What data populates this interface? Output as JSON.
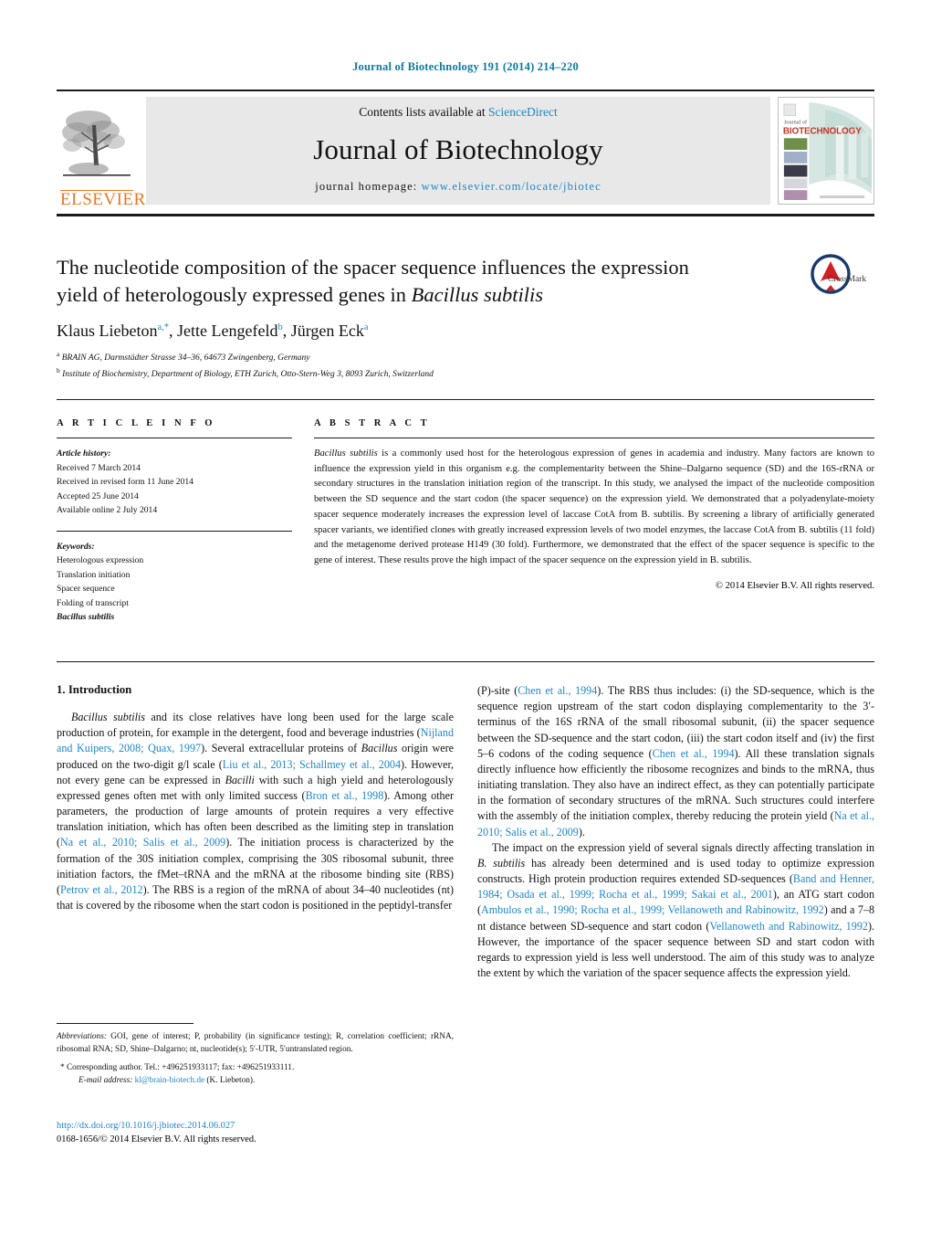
{
  "running_head": "Journal of Biotechnology 191 (2014) 214–220",
  "masthead": {
    "contents_prefix": "Contents lists available at ",
    "sciencedirect": "ScienceDirect",
    "journal_title": "Journal of Biotechnology",
    "homepage_label": "journal homepage:",
    "homepage_url": "www.elsevier.com/locate/jbiotec",
    "publisher": "ELSEVIER",
    "cover_line1": "Journal of",
    "cover_line2": "BIOTECHNOLOGY",
    "link_color": "#1f86c8",
    "brand_orange": "#E77726"
  },
  "article": {
    "title_part1": "The nucleotide composition of the spacer sequence influences the expression yield of heterologously expressed genes in ",
    "title_italic": "Bacillus subtilis",
    "authors_html": "Klaus Liebeton, Jette Lengefeld, Jürgen Eck",
    "authors": [
      {
        "name": "Klaus Liebeton",
        "sup": "a,*"
      },
      {
        "name": "Jette Lengefeld",
        "sup": "b"
      },
      {
        "name": "Jürgen Eck",
        "sup": "a"
      }
    ],
    "affiliations": [
      {
        "sup": "a",
        "text": "BRAIN AG, Darmstädter Strasse 34–36, 64673 Zwingenberg, Germany"
      },
      {
        "sup": "b",
        "text": "Institute of Biochemistry, Department of Biology, ETH Zurich, Otto-Stern-Weg 3, 8093 Zurich, Switzerland"
      }
    ],
    "crossmark_label": "CrossMark"
  },
  "article_info": {
    "heading": "A R T I C L E   I N F O",
    "history_label": "Article history:",
    "history": [
      "Received 7 March 2014",
      "Received in revised form 11 June 2014",
      "Accepted 25 June 2014",
      "Available online 2 July 2014"
    ],
    "keywords_label": "Keywords:",
    "keywords": [
      "Heterologous expression",
      "Translation initiation",
      "Spacer sequence",
      "Folding of transcript",
      "Bacillus subtilis"
    ]
  },
  "abstract": {
    "heading": "A B S T R A C T",
    "lead_italic": "Bacillus subtilis",
    "text": " is a commonly used host for the heterologous expression of genes in academia and industry. Many factors are known to influence the expression yield in this organism e.g. the complementarity between the Shine–Dalgarno sequence (SD) and the 16S-rRNA or secondary structures in the translation initiation region of the transcript. In this study, we analysed the impact of the nucleotide composition between the SD sequence and the start codon (the spacer sequence) on the expression yield. We demonstrated that a polyadenylate-moiety spacer sequence moderately increases the expression level of laccase CotA from B. subtilis. By screening a library of artificially generated spacer variants, we identified clones with greatly increased expression levels of two model enzymes, the laccase CotA from B. subtilis (11 fold) and the metagenome derived protease H149 (30 fold). Furthermore, we demonstrated that the effect of the spacer sequence is specific to the gene of interest. These results prove the high impact of the spacer sequence on the expression yield in B. subtilis.",
    "copyright": "© 2014 Elsevier B.V. All rights reserved."
  },
  "introduction": {
    "section_number": "1.",
    "section_title": "Introduction",
    "paragraph_1": "Bacillus subtilis and its close relatives have long been used for the large scale production of protein, for example in the detergent, food and beverage industries (Nijland and Kuipers, 2008; Quax, 1997). Several extracellular proteins of Bacillus origin were produced on the two-digit g/l scale (Liu et al., 2013; Schallmey et al., 2004). However, not every gene can be expressed in Bacilli with such a high yield and heterologously expressed genes often met with only limited success (Bron et al., 1998). Among other parameters, the production of large amounts of protein requires a very effective translation initiation, which has often been described as the limiting step in translation (Na et al., 2010; Salis et al., 2009). The initiation process is characterized by the formation of the 30S initiation complex, comprising the 30S ribosomal subunit, three initiation factors, the fMet–tRNA and the mRNA at the ribosome binding site (RBS) (Petrov et al., 2012). The RBS is a region of the mRNA of about 34–40 nucleotides (nt) that is covered by the ribosome when the start codon is positioned in the peptidyl-transfer (P)-site (Chen et al., 1994). The RBS thus includes: (i) the SD-sequence, which is the sequence region upstream of the start codon displaying complementarity to the 3′-terminus of the 16S rRNA of the small ribosomal subunit, (ii) the spacer sequence between the SD-sequence and the start codon, (iii) the start codon itself and (iv) the first 5–6 codons of the coding sequence (Chen et al., 1994). All these translation signals directly influence how efficiently the ribosome recognizes and binds to the mRNA, thus initiating translation. They also have an indirect effect, as they can potentially participate in the formation of secondary structures of the mRNA. Such structures could interfere with the assembly of the initiation complex, thereby reducing the protein yield (Na et al., 2010; Salis et al., 2009).",
    "paragraph_2": "The impact on the expression yield of several signals directly affecting translation in B. subtilis has already been determined and is used today to optimize expression constructs. High protein production requires extended SD-sequences (Band and Henner, 1984; Osada et al., 1999; Rocha et al., 1999; Sakai et al., 2001), an ATG start codon (Ambulos et al., 1990; Rocha et al., 1999; Vellanoweth and Rabinowitz, 1992) and a 7–8 nt distance between SD-sequence and start codon (Vellanoweth and Rabinowitz, 1992). However, the importance of the spacer sequence between SD and start codon with regards to expression yield is less well understood. The aim of this study was to analyze the extent by which the variation of the spacer sequence affects the expression yield."
  },
  "footnotes": {
    "abbrev_label": "Abbreviations:",
    "abbrev_text": " GOI, gene of interest; P, probability (in significance testing); R, correlation coefficient; rRNA, ribosomal RNA; SD, Shine–Dalgarno; nt, nucleotide(s); 5′-UTR, 5′untranslated region.",
    "corresponding_marker": "*",
    "corresponding_text": "Corresponding author. Tel.: +496251933117; fax: +496251933111.",
    "email_label": "E-mail address:",
    "email": "kl@brain-biotech.de",
    "email_suffix": " (K. Liebeton).",
    "doi_url": "http://dx.doi.org/10.1016/j.jbiotec.2014.06.027",
    "issn_line": "0168-1656/© 2014 Elsevier B.V. All rights reserved."
  }
}
